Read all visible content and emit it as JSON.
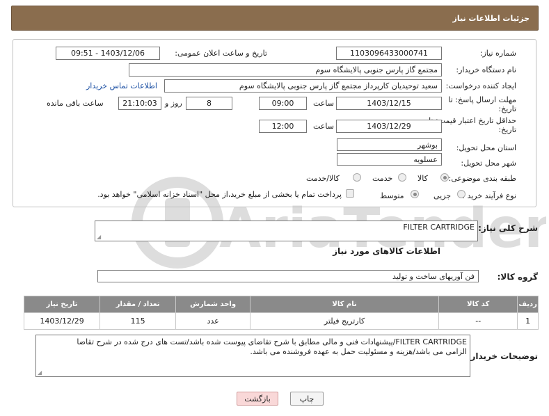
{
  "header": {
    "title": "جزئیات اطلاعات نیاز"
  },
  "fields": {
    "need_number_label": "شماره نیاز:",
    "need_number": "1103096433000741",
    "announce_label": "تاریخ و ساعت اعلان عمومی:",
    "announce_value": "1403/12/06 - 09:51",
    "buyer_org_label": "نام دستگاه خریدار:",
    "buyer_org": "مجتمع گاز پارس جنوبی  پالایشگاه سوم",
    "requester_label": "ایجاد کننده درخواست:",
    "requester": "سعید توحیدیان کارپرداز مجتمع گاز پارس جنوبی  پالایشگاه سوم",
    "contact_link": "اطلاعات تماس خریدار",
    "deadline_label_1": "مهلت ارسال پاسخ: تا",
    "deadline_label_2": "تاریخ:",
    "deadline_date": "1403/12/15",
    "time_label": "ساعت",
    "deadline_time": "09:00",
    "days_value": "8",
    "days_label": "روز و",
    "remaining_time": "21:10:03",
    "remaining_label": "ساعت باقی مانده",
    "validity_label_1": "حداقل تاریخ اعتبار قیمت: تا",
    "validity_label_2": "تاریخ:",
    "validity_date": "1403/12/29",
    "validity_time_label": "ساعت",
    "validity_time": "12:00",
    "province_label": "استان محل تحویل:",
    "province": "بوشهر",
    "city_label": "شهر محل تحویل:",
    "city": "عسلویه",
    "category_label": "طبقه بندی موضوعی:",
    "category_options": [
      "کالا",
      "خدمت",
      "کالا/خدمت"
    ],
    "process_label": "نوع فرآیند خرید :",
    "process_options": [
      "جزیی",
      "متوسط"
    ],
    "payment_note": "پرداخت تمام یا بخشی از مبلغ خرید،از محل \"اسناد خزانه اسلامی\" خواهد بود."
  },
  "summary": {
    "label": "شرح کلی نیاز:",
    "value": "FILTER CARTRIDGE"
  },
  "goods_info_title": "اطلاعات کالاهای مورد نیاز",
  "goods_group": {
    "label": "گروه کالا:",
    "value": "فن آوریهای ساخت و تولید"
  },
  "table": {
    "headers": [
      "ردیف",
      "کد کالا",
      "نام کالا",
      "واحد شمارش",
      "تعداد / مقدار",
      "تاریخ نیاز"
    ],
    "rows": [
      [
        "1",
        "--",
        "کارتریج فیلتر",
        "عدد",
        "115",
        "1403/12/29"
      ]
    ]
  },
  "buyer_notes": {
    "label": "توضیحات خریدار:",
    "line1": "FILTER CARTRIDGE/پیشنهادات فنی و مالی مطابق با شرح تقاضای پیوست شده باشد/تست های درج شده در شرح تقاضا",
    "line2": "الزامی می باشد/هزینه و مسئولیت حمل به عهده فروشنده می باشد."
  },
  "buttons": {
    "print": "چاپ",
    "back": "بازگشت"
  },
  "watermark": {
    "text": "AriaTender.net"
  },
  "colors": {
    "header": "#8a6d4e",
    "table_header": "#8a8a8a",
    "link": "#1b4fa3",
    "back_button": "#f9d8d8"
  }
}
